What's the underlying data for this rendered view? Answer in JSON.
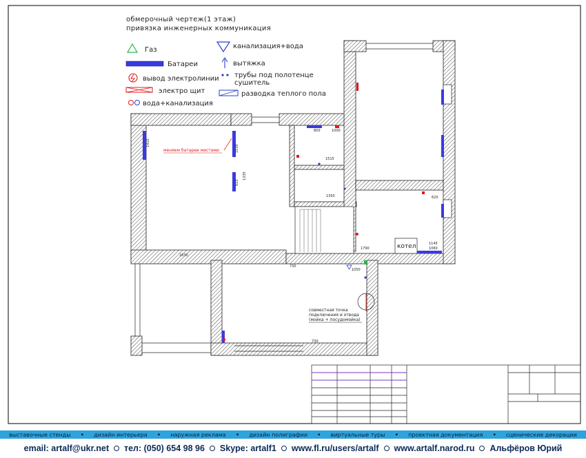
{
  "title": {
    "line1": "обмерочный чертеж(1 этаж)",
    "line2": "привязка инженерных коммуникация"
  },
  "legend": {
    "left": [
      {
        "icon": "gas-triangle-icon",
        "label": "Газ",
        "color": "#2db34a"
      },
      {
        "icon": "radiator-bar-icon",
        "label": "Батареи",
        "color": "#3a3ae0"
      },
      {
        "icon": "power-outlet-icon",
        "label": "вывод электролинии",
        "color": "#e01818"
      },
      {
        "icon": "electric-panel-icon",
        "label": "электро щит",
        "color": "#e01818"
      },
      {
        "icon": "water-sewer-circles-icon",
        "label": "вода+канализация",
        "color": "#e01818"
      }
    ],
    "right": [
      {
        "icon": "sewer-water-triangle-icon",
        "label": "канализация+вода",
        "color": "#2a3fd0"
      },
      {
        "icon": "exhaust-arrow-icon",
        "label": "вытяжка",
        "color": "#2a3fd0"
      },
      {
        "icon": "towel-pipe-dots-icon",
        "label": "трубы под полотенце",
        "label2": "сушитель",
        "color": "#2a3fd0"
      },
      {
        "icon": "floor-heating-icon",
        "label": "разводка теплого пола",
        "color": "#2a3fd0"
      }
    ]
  },
  "annotations": {
    "red_note": "меняем батареи местами",
    "kotel": "котел",
    "note_line1": "совместная точка",
    "note_line2": "подключения и отвода",
    "note_line3": "(мойка + посудомойка)"
  },
  "dimensions": [
    "1410",
    "1530",
    "1335",
    "610",
    "800",
    "1000",
    "1515",
    "1350",
    "620",
    "1145",
    "1060",
    "730",
    "1050",
    "730",
    "1790",
    "1630"
  ],
  "footer": {
    "services": [
      "выставочные стенды",
      "дизайн интерьера",
      "наружная реклама",
      "дизайн полиграфии",
      "виртуальные туры",
      "проектная документация",
      "сценические декорации"
    ],
    "contacts": [
      "email: artalf@ukr.net",
      "тел: (050) 654 98 96",
      "Skype: artalf1",
      "www.fl.ru/users/artalf",
      "www.artalf.narod.ru",
      "Альфёров Юрий"
    ]
  },
  "colors": {
    "radiator": "#3a3ae0",
    "electric": "#e01818",
    "gas": "#2db34a",
    "water": "#2a3fd0",
    "footer_band": "#2fa3dc",
    "footer_text": "#0b2a5a"
  }
}
